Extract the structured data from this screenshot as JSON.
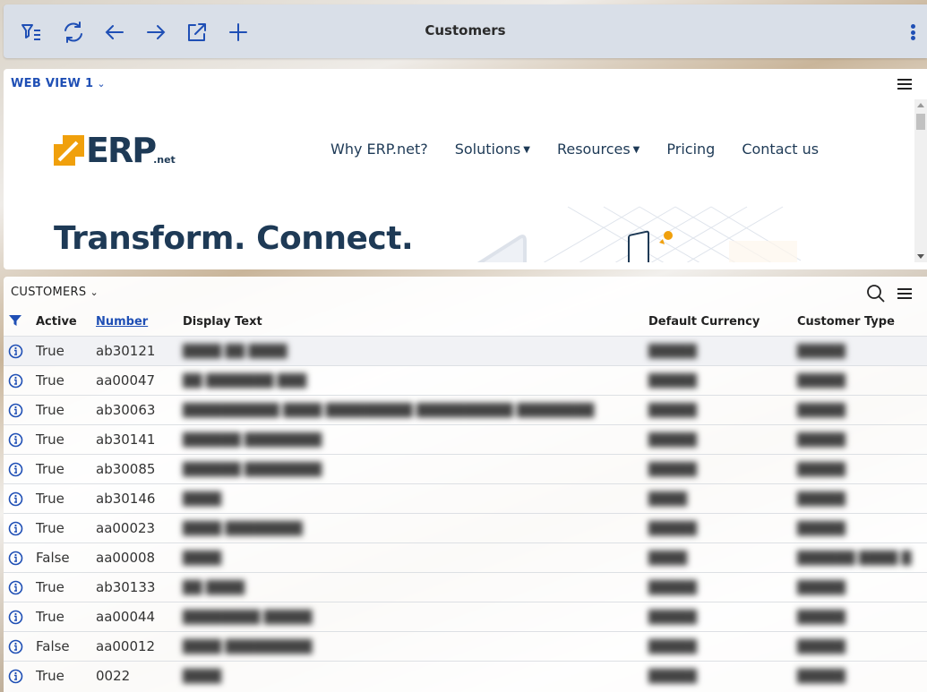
{
  "toolbar": {
    "title": "Customers",
    "icons": [
      "filter-list-icon",
      "refresh-icon",
      "back-arrow-icon",
      "forward-arrow-icon",
      "open-external-icon",
      "add-icon"
    ],
    "accent": "#1f4fb5"
  },
  "webview": {
    "panel_title": "WEB VIEW 1",
    "site": {
      "logo_text": "ERP",
      "logo_suffix": ".net",
      "nav": [
        {
          "label": "Why ERP.net?",
          "dropdown": false
        },
        {
          "label": "Solutions",
          "dropdown": true
        },
        {
          "label": "Resources",
          "dropdown": true
        },
        {
          "label": "Pricing",
          "dropdown": false
        },
        {
          "label": "Contact us",
          "dropdown": false
        }
      ],
      "hero": "Transform. Connect.",
      "brand_color": "#1e3a56",
      "logo_accent": "#f0a00c"
    }
  },
  "customers": {
    "panel_title": "CUSTOMERS",
    "columns": [
      "Active",
      "Number",
      "Display Text",
      "Default Currency",
      "Customer Type"
    ],
    "sorted_column": "Number",
    "rows": [
      {
        "active": "True",
        "number": "ab30121",
        "display": "████ ██ ████",
        "currency": "█████",
        "type": "█████"
      },
      {
        "active": "True",
        "number": "aa00047",
        "display": "██ ███████ ███",
        "currency": "█████",
        "type": "█████"
      },
      {
        "active": "True",
        "number": "ab30063",
        "display": "██████████ ████ █████████ ██████████ ████████",
        "currency": "█████",
        "type": "█████"
      },
      {
        "active": "True",
        "number": "ab30141",
        "display": "██████ ████████",
        "currency": "█████",
        "type": "█████"
      },
      {
        "active": "True",
        "number": "ab30085",
        "display": "██████ ████████",
        "currency": "█████",
        "type": "█████"
      },
      {
        "active": "True",
        "number": "ab30146",
        "display": "████",
        "currency": "████",
        "type": "█████"
      },
      {
        "active": "True",
        "number": "aa00023",
        "display": "████ ████████",
        "currency": "█████",
        "type": "█████"
      },
      {
        "active": "False",
        "number": "aa00008",
        "display": "████",
        "currency": "████",
        "type": "██████ ████ █"
      },
      {
        "active": "True",
        "number": "ab30133",
        "display": "██ ████",
        "currency": "█████",
        "type": "█████"
      },
      {
        "active": "True",
        "number": "aa00044",
        "display": "████████ █████",
        "currency": "█████",
        "type": "█████"
      },
      {
        "active": "False",
        "number": "aa00012",
        "display": "████ █████████",
        "currency": "█████",
        "type": "█████"
      },
      {
        "active": "True",
        "number": "0022",
        "display": "████",
        "currency": "█████",
        "type": "█████"
      }
    ]
  }
}
